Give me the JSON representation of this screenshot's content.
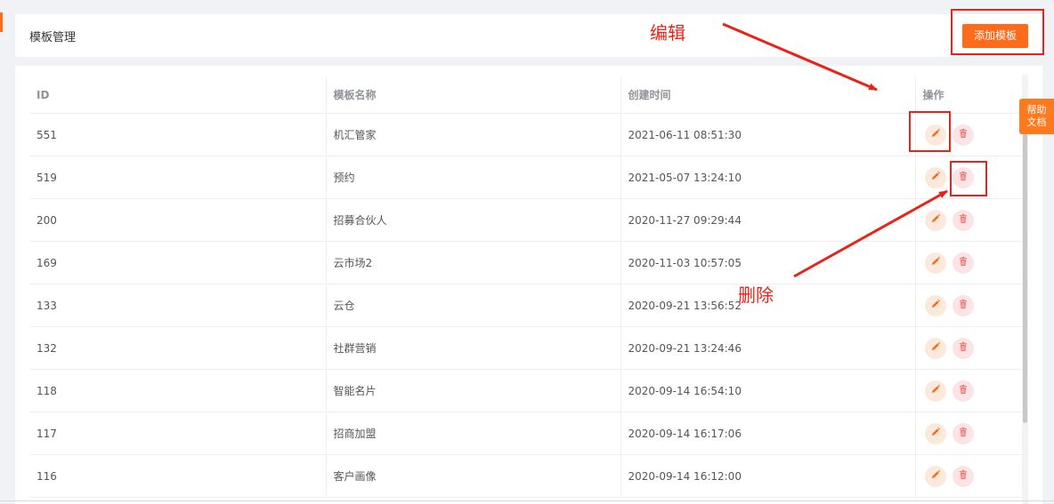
{
  "header": {
    "title": "模板管理",
    "add_label": "添加模板"
  },
  "table": {
    "columns": {
      "id": "ID",
      "name": "模板名称",
      "created": "创建时间",
      "ops": "操作"
    },
    "rows": [
      {
        "id": "551",
        "name": "机汇管家",
        "created": "2021-06-11 08:51:30"
      },
      {
        "id": "519",
        "name": "预约",
        "created": "2021-05-07 13:24:10"
      },
      {
        "id": "200",
        "name": "招募合伙人",
        "created": "2020-11-27 09:29:44"
      },
      {
        "id": "169",
        "name": "云市场2",
        "created": "2020-11-03 10:57:05"
      },
      {
        "id": "133",
        "name": "云仓",
        "created": "2020-09-21 13:56:52"
      },
      {
        "id": "132",
        "name": "社群营销",
        "created": "2020-09-21 13:24:46"
      },
      {
        "id": "118",
        "name": "智能名片",
        "created": "2020-09-14 16:54:10"
      },
      {
        "id": "117",
        "name": "招商加盟",
        "created": "2020-09-14 16:17:06"
      },
      {
        "id": "116",
        "name": "客户画像",
        "created": "2020-09-14 16:12:00"
      }
    ]
  },
  "help": {
    "line1": "帮助",
    "line2": "文档"
  },
  "annotations": {
    "edit_label": "编辑",
    "delete_label": "删除"
  },
  "icons": {
    "edit": "pencil-icon",
    "delete": "trash-icon"
  },
  "colors": {
    "accent": "#ff6b1a",
    "annotation": "#e8231a",
    "delete_icon": "#f07070"
  }
}
